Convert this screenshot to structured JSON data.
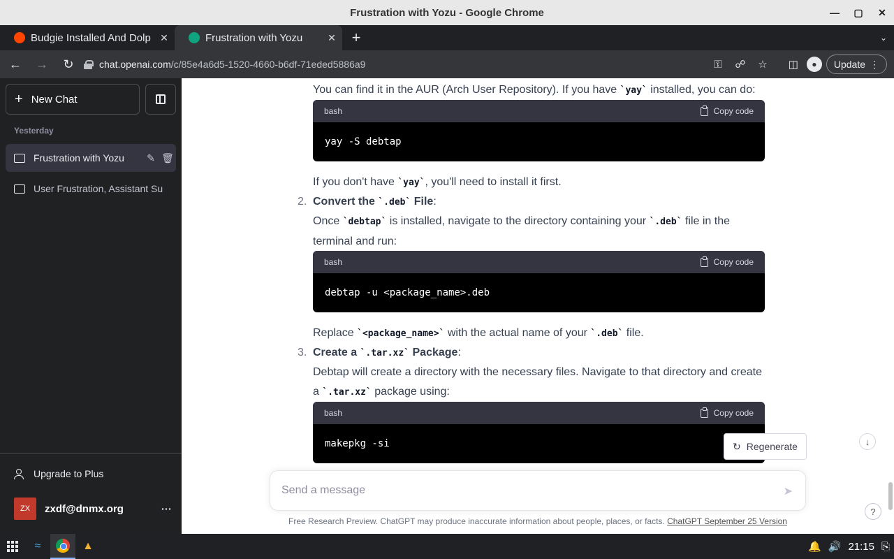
{
  "window": {
    "title": "Frustration with Yozu - Google Chrome"
  },
  "tabs": [
    {
      "label": "Budgie Installed And Dolp",
      "favicon": "reddit-icon",
      "color": "#ff4500"
    },
    {
      "label": "Frustration with Yozu",
      "favicon": "openai-icon",
      "color": "#10a37f"
    }
  ],
  "address": {
    "host": "chat.openai.com",
    "path": "/c/85e4a6d5-1520-4660-b6df-71eded5886a9"
  },
  "toolbar": {
    "update_label": "Update"
  },
  "sidebar": {
    "new_chat": "New Chat",
    "section": "Yesterday",
    "conversations": [
      {
        "title": "Frustration with Yozu",
        "selected": true
      },
      {
        "title": "User Frustration, Assistant Su",
        "selected": false
      }
    ],
    "upgrade": "Upgrade to Plus",
    "user": {
      "initials": "ZX",
      "email": "zxdf@dnmx.org"
    }
  },
  "chat": {
    "p1": {
      "before": "You can find it in the AUR (Arch User Repository). If you have ",
      "code": "`yay`",
      "after": " installed, you can do:"
    },
    "code1": {
      "lang": "bash",
      "copy": "Copy code",
      "text": "yay -S debtap"
    },
    "p2": {
      "before": "If you don't have ",
      "code": "`yay`",
      "after": ", you'll need to install it first."
    },
    "step2": {
      "num": "2.",
      "bold1": "Convert the ",
      "code": "`.deb`",
      "bold2": " File",
      "colon": ":"
    },
    "p3": {
      "a": "Once ",
      "code1": "`debtap`",
      "b": " is installed, navigate to the directory containing your ",
      "code2": "`.deb`",
      "c": " file in the terminal and run:"
    },
    "code2": {
      "lang": "bash",
      "copy": "Copy code",
      "text": "debtap -u <package_name>.deb"
    },
    "p4": {
      "a": "Replace ",
      "code1": "`<package_name>`",
      "b": " with the actual name of your ",
      "code2": "`.deb`",
      "c": " file."
    },
    "step3": {
      "num": "3.",
      "bold1": "Create a ",
      "code": "`.tar.xz`",
      "bold2": " Package",
      "colon": ":"
    },
    "p5": {
      "a": "Debtap will create a directory with the necessary files. Navigate to that directory and create a ",
      "code": "`.tar.xz`",
      "b": " package using:"
    },
    "code3": {
      "lang": "bash",
      "copy": "Copy code",
      "text": "makepkg -si"
    },
    "regenerate": "Regenerate",
    "input_placeholder": "Send a message",
    "footer_text": "Free Research Preview. ChatGPT may produce inaccurate information about people, places, or facts. ",
    "footer_link": "ChatGPT September 25 Version",
    "help": "?"
  },
  "taskbar": {
    "time": "21:15"
  }
}
